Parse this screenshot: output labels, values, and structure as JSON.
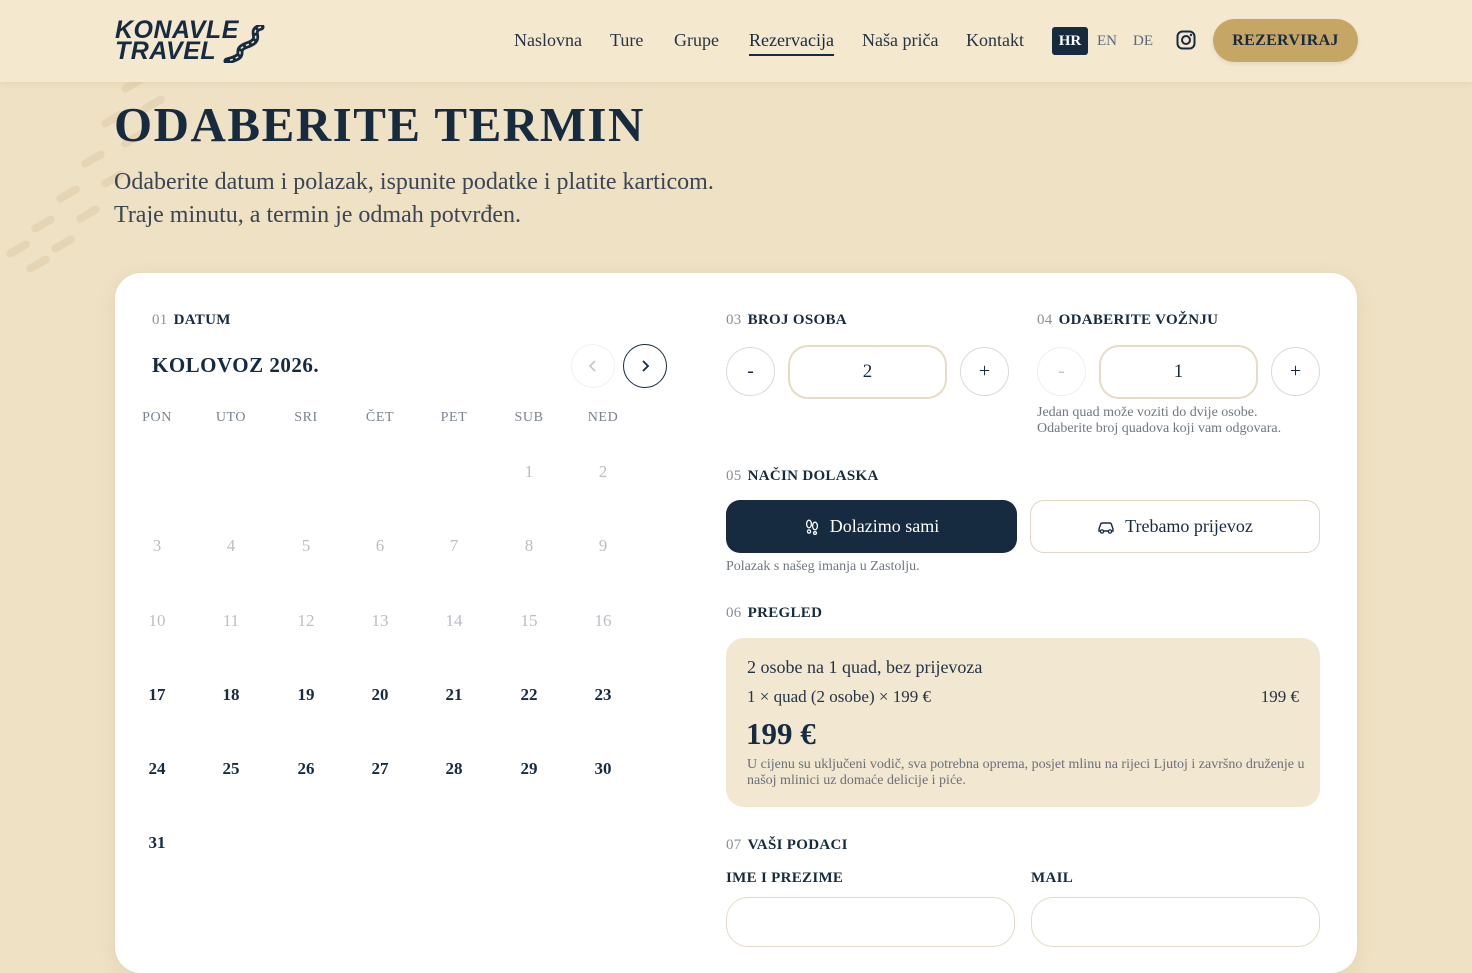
{
  "header": {
    "logo": {
      "line1": "KONAVLE",
      "line2": "TRAVEL"
    },
    "nav": [
      {
        "label": "Naslovna",
        "active": false
      },
      {
        "label": "Ture",
        "active": false
      },
      {
        "label": "Grupe",
        "active": false
      },
      {
        "label": "Rezervacija",
        "active": true
      },
      {
        "label": "Naša priča",
        "active": false
      },
      {
        "label": "Kontakt",
        "active": false
      }
    ],
    "languages": [
      {
        "code": "HR",
        "selected": true
      },
      {
        "code": "EN",
        "selected": false
      },
      {
        "code": "DE",
        "selected": false
      }
    ],
    "instagram_icon": "instagram-icon",
    "cta_label": "REZERVIRAJ"
  },
  "hero": {
    "title": "ODABERITE TERMIN",
    "subtitle_line1": "Odaberite datum i polazak, ispunite podatke i platite karticom.",
    "subtitle_line2": "Traje minutu, a termin je odmah potvrđen."
  },
  "booking": {
    "date_section": {
      "num": "01",
      "label": "DATUM"
    },
    "calendar": {
      "month_label": "KOLOVOZ 2026.",
      "prev_icon": "chevron-left-icon",
      "next_icon": "chevron-right-icon",
      "weekdays": [
        "PON",
        "UTO",
        "SRI",
        "ČET",
        "PET",
        "SUB",
        "NED"
      ],
      "first_weekday_index": 5,
      "days_in_month": 31,
      "first_available_day": 17
    },
    "persons": {
      "num": "03",
      "label": "BROJ OSOBA",
      "value": "2",
      "minus": "-",
      "plus": "+"
    },
    "rides": {
      "num": "04",
      "label": "ODABERITE VOŽNJU",
      "value": "1",
      "minus": "-",
      "plus": "+",
      "hint_line1": "Jedan quad može voziti do dvije osobe.",
      "hint_line2": "Odaberite broj quadova koji vam odgovara."
    },
    "arrival": {
      "num": "05",
      "label": "NAČIN DOLASKA",
      "option_self": "Dolazimo sami",
      "option_self_icon": "footprints-icon",
      "option_transfer": "Trebamo prijevoz",
      "option_transfer_icon": "car-icon",
      "selected": "self",
      "hint": "Polazak s našeg imanja u Zastolju."
    },
    "overview": {
      "num": "06",
      "label": "PREGLED",
      "headline": "2 osobe na 1 quad, bez prijevoza",
      "line_item": "1 × quad (2 osobe) × 199 €",
      "line_item_price": "199 €",
      "total": "199 €",
      "note": "U cijenu su uključeni vodič, sva potrebna oprema, posjet mlinu na rijeci Ljutoj i završno druženje u našoj mlinici uz domaće delicije i piće."
    },
    "your_data": {
      "num": "07",
      "label": "VAŠI PODACI",
      "name_label": "IME I PREZIME",
      "mail_label": "MAIL"
    }
  },
  "colors": {
    "navy": "#162a40",
    "gold": "#c6a664",
    "cream": "#efe1c3",
    "summary_bg": "#f2e7d1"
  }
}
